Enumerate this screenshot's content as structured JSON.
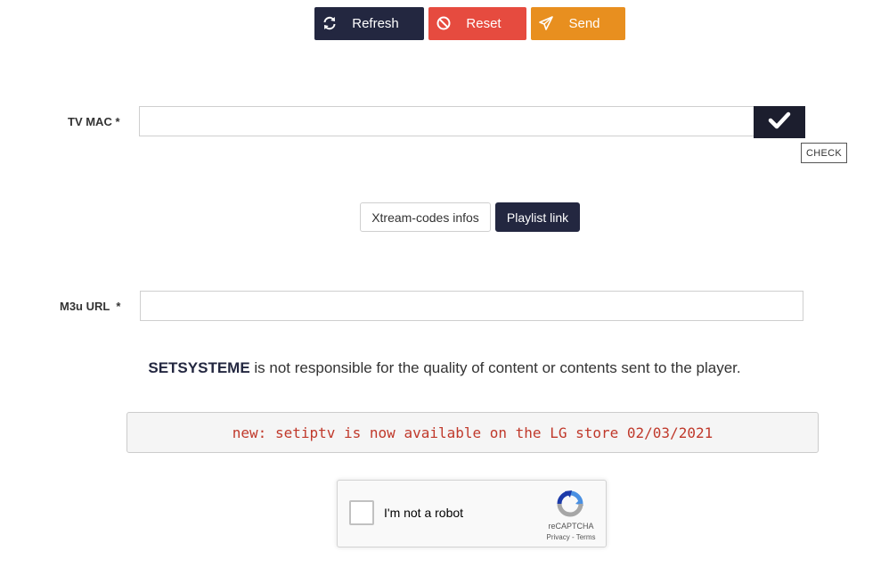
{
  "toolbar": {
    "refresh_label": "Refresh",
    "reset_label": "Reset",
    "send_label": "Send"
  },
  "mac": {
    "label": "TV MAC *",
    "value": "",
    "tooltip": "CHECK"
  },
  "tabs": [
    {
      "label": "Xtream-codes infos",
      "active": false
    },
    {
      "label": "Playlist link",
      "active": true
    }
  ],
  "m3u": {
    "label": "M3u URL  *",
    "value": ""
  },
  "disclaimer": {
    "brand": "SETSYSTEME",
    "text": " is not responsible for the quality of content or contents sent to the player."
  },
  "notice": "new: setiptv is now available on the LG store 02/03/2021",
  "captcha": {
    "label": "I'm not a robot",
    "brand": "reCAPTCHA",
    "links": "Privacy - Terms"
  },
  "colors": {
    "navy": "#232740",
    "reset": "#e64b3f",
    "send": "#e88f1f",
    "notice_text": "#c0392b"
  },
  "icons": {
    "refresh": "refresh-icon",
    "reset": "ban-icon",
    "send": "paper-plane-icon",
    "check": "checkmark-icon",
    "captcha": "recaptcha-logo-icon"
  }
}
